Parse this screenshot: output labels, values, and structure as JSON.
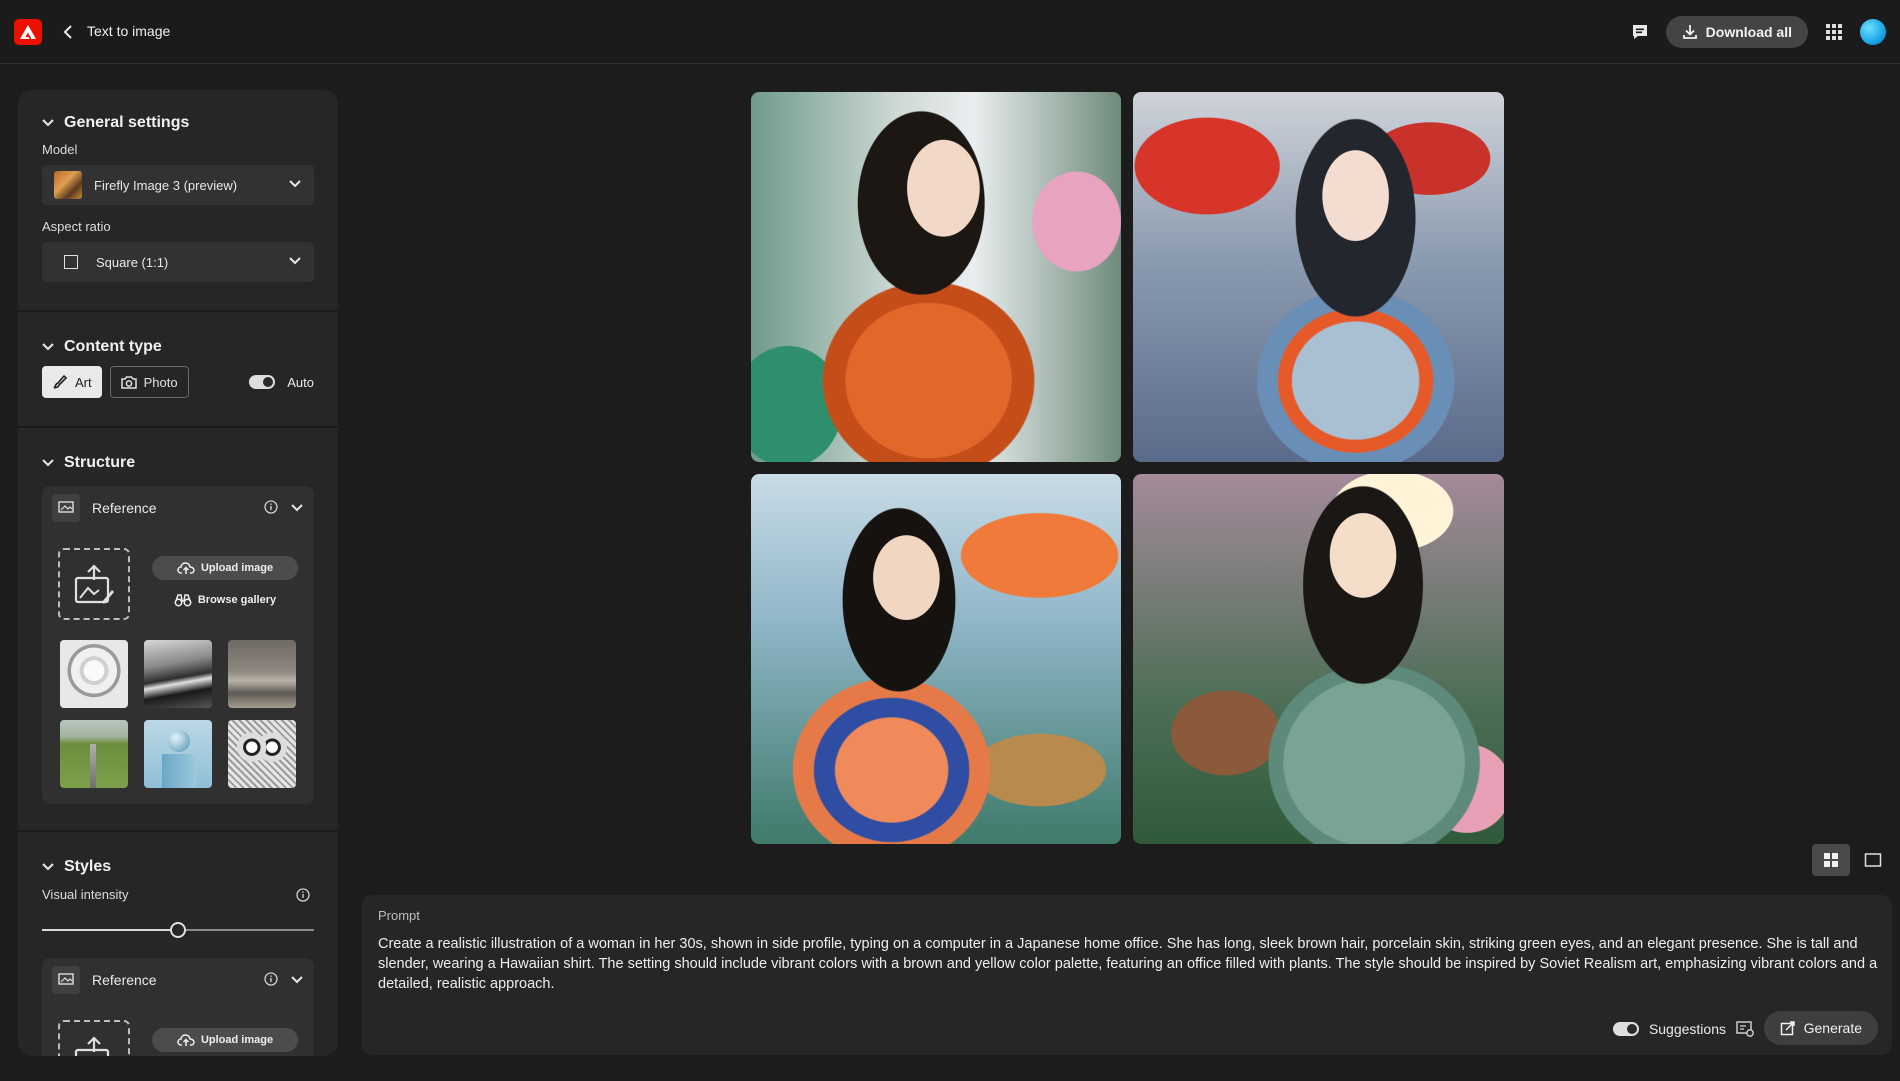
{
  "header": {
    "title": "Text to image",
    "download_label": "Download all",
    "logo_icon": "adobe-logo-icon",
    "accent": "#eb1000"
  },
  "panel": {
    "general": {
      "heading": "General settings",
      "model_label": "Model",
      "model_value": "Firefly Image 3 (preview)",
      "aspect_label": "Aspect ratio",
      "aspect_value": "Square (1:1)"
    },
    "content_type": {
      "heading": "Content type",
      "art_label": "Art",
      "photo_label": "Photo",
      "auto_label": "Auto",
      "selected": "Art"
    },
    "structure": {
      "heading": "Structure",
      "reference_label": "Reference",
      "upload_label": "Upload image",
      "browse_label": "Browse gallery",
      "thumbnails": [
        "sketch-bird",
        "bw-landscape",
        "living-room",
        "green-road",
        "blue-sphere",
        "owl-drawing"
      ]
    },
    "styles": {
      "heading": "Styles",
      "intensity_label": "Visual intensity",
      "intensity_value": 0.5,
      "reference_label": "Reference",
      "upload_label": "Upload image"
    }
  },
  "gallery": {
    "images": [
      {
        "alt": "woman in orange kimono typing at computer"
      },
      {
        "alt": "woman in blue kimono under red trees"
      },
      {
        "alt": "woman with orange blossoms at desk"
      },
      {
        "alt": "woman in green kimono at keyboard"
      }
    ]
  },
  "prompt": {
    "label": "Prompt",
    "text": "Create a realistic illustration of a woman in her 30s, shown in side profile, typing on a computer in a Japanese home office. She has long, sleek brown hair, porcelain skin, striking green eyes, and an elegant presence. She is tall and slender, wearing a Hawaiian shirt. The setting should include vibrant colors with a brown and yellow color palette, featuring an office filled with plants. The style should be inspired by Soviet Realism art, emphasizing vibrant colors and a detailed, realistic approach.",
    "suggestions_label": "Suggestions",
    "generate_label": "Generate"
  }
}
